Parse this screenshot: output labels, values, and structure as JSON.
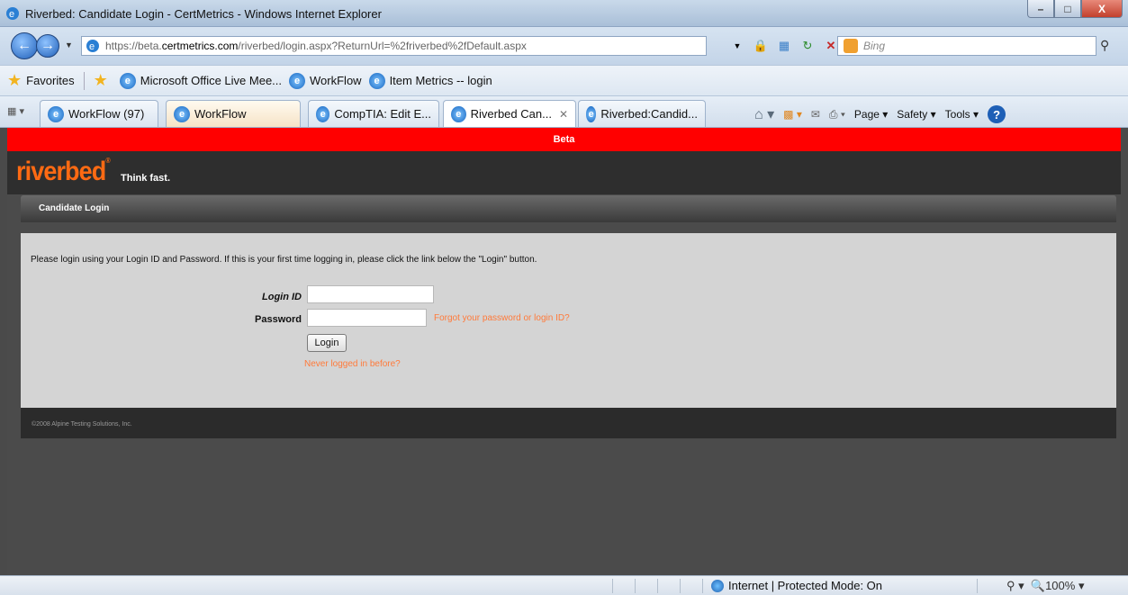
{
  "window": {
    "title": "Riverbed: Candidate Login - CertMetrics - Windows Internet Explorer",
    "minimize": "–",
    "maximize": "□",
    "close": "X"
  },
  "address": {
    "url_prefix": "https://beta.",
    "url_domain": "certmetrics.com",
    "url_path": "/riverbed/login.aspx?ReturnUrl=%2friverbed%2fDefault.aspx",
    "search_placeholder": "Bing"
  },
  "favorites": {
    "label": "Favorites",
    "items": [
      "Microsoft Office Live Mee...",
      "WorkFlow",
      "Item Metrics -- login"
    ]
  },
  "tabs": [
    {
      "label": "WorkFlow (97)"
    },
    {
      "label": "WorkFlow"
    },
    {
      "label": "CompTIA: Edit E..."
    },
    {
      "label": "Riverbed Can..."
    },
    {
      "label": "Riverbed:Candid..."
    }
  ],
  "commands": {
    "page": "Page",
    "safety": "Safety",
    "tools": "Tools"
  },
  "page": {
    "beta_label": "Beta",
    "logo": "riverbed",
    "tagline": "Think fast.",
    "panel_title": "Candidate Login",
    "instructions": "Please login using your Login ID and Password. If this is your first time logging in, please click the link below the \"Login\" button.",
    "login_id_label": "Login ID",
    "password_label": "Password",
    "forgot_link": "Forgot your password or login ID?",
    "login_button": "Login",
    "never_link": "Never logged in before?",
    "copyright": "©2008 Alpine Testing Solutions, Inc."
  },
  "status": {
    "zone": "Internet | Protected Mode: On",
    "zoom": "100%"
  }
}
